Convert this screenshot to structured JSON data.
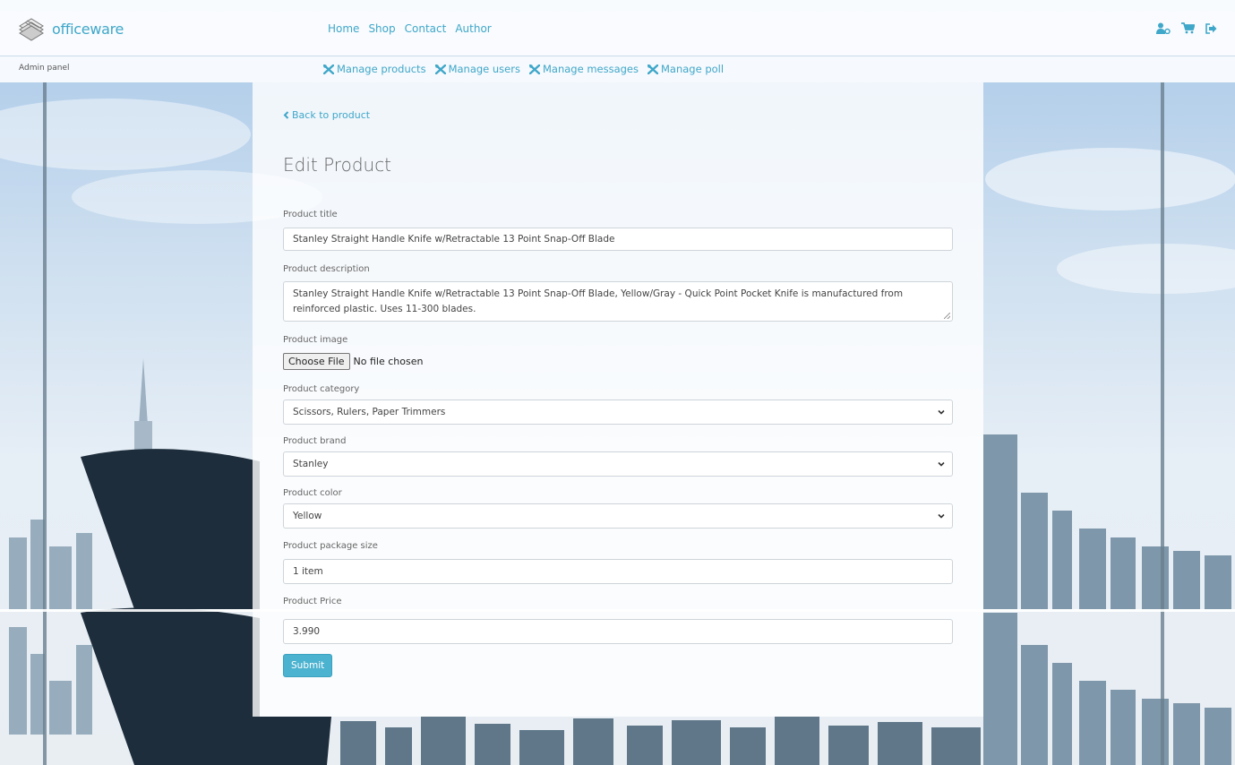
{
  "header": {
    "brand_name": "officeware",
    "nav": [
      "Home",
      "Shop",
      "Contact",
      "Author"
    ],
    "icons": [
      "user-cog-icon",
      "cart-icon",
      "logout-icon"
    ],
    "accent_color": "#3fa7c9"
  },
  "admin_bar": {
    "label": "Admin panel",
    "items": [
      {
        "label": "Manage products",
        "icon": "tools-icon"
      },
      {
        "label": "Manage users",
        "icon": "tools-icon"
      },
      {
        "label": "Manage messages",
        "icon": "tools-icon"
      },
      {
        "label": "Manage poll",
        "icon": "tools-icon"
      }
    ]
  },
  "form": {
    "back_link": "Back to product",
    "title": "Edit Product",
    "title_label": "Product title",
    "title_value": "Stanley Straight Handle Knife w/Retractable 13 Point Snap-Off Blade",
    "description_label": "Product description",
    "description_value": "Stanley Straight Handle Knife w/Retractable 13 Point Snap-Off Blade, Yellow/Gray - Quick Point Pocket Knife is manufactured from reinforced plastic. Uses 11-300 blades.",
    "image_label": "Product image",
    "file_button": "Choose File",
    "file_status": "No file chosen",
    "category_label": "Product category",
    "category_value": "Scissors, Rulers, Paper Trimmers",
    "brand_label": "Product brand",
    "brand_value": "Stanley",
    "color_label": "Product color",
    "color_value": "Yellow",
    "package_label": "Product package size",
    "package_value": "1 item",
    "price_label": "Product Price",
    "price_value": "3.990",
    "submit_label": "Submit",
    "submit_color": "#4bb2cf"
  }
}
